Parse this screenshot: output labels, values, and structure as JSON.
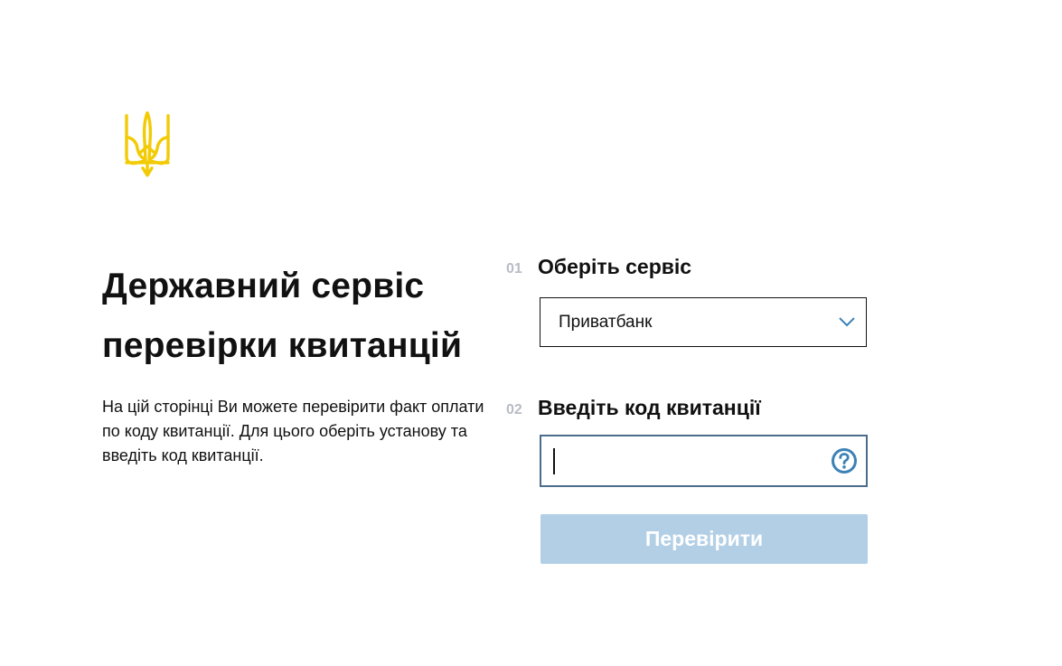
{
  "colors": {
    "emblem": "#f2cb05",
    "primary_button_disabled": "#b2cfe6",
    "input_focus_border": "#4a6d8c",
    "help_icon": "#3d82b7",
    "step_number": "#b7bcc5"
  },
  "header": {
    "emblem_icon": "trident-icon"
  },
  "intro": {
    "title_line1": "Державний сервіс",
    "title_line2": "перевірки квитанцій",
    "description": "На цій сторінці Ви можете перевірити факт оплати по коду квитанції. Для цього оберіть установу та введіть код квитанції."
  },
  "form": {
    "step1": {
      "number": "01",
      "label": "Оберіть сервіс",
      "selected_value": "Приватбанк",
      "icon": "chevron-down-icon"
    },
    "step2": {
      "number": "02",
      "label": "Введіть код квитанції",
      "value": "",
      "placeholder": "",
      "help_icon": "question-circle-icon"
    },
    "submit_label": "Перевірити"
  }
}
